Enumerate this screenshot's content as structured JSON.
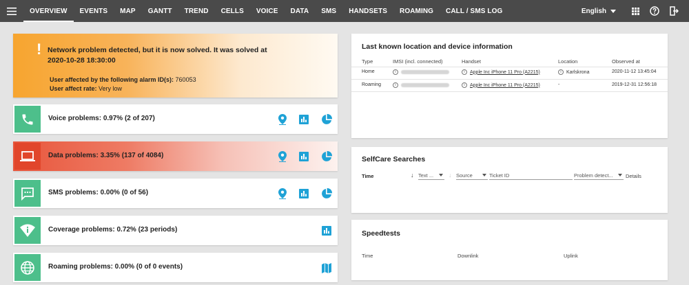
{
  "nav": {
    "items": [
      "OVERVIEW",
      "EVENTS",
      "MAP",
      "GANTT",
      "TREND",
      "CELLS",
      "VOICE",
      "DATA",
      "SMS",
      "HANDSETS",
      "ROAMING",
      "CALL / SMS LOG"
    ],
    "active": "OVERVIEW",
    "language": "English"
  },
  "alarm": {
    "message": "Network problem detected, but it is now solved. It was solved at 2020-10-28 18:30:00",
    "alarm_label": "User affected by the following alarm ID(s):",
    "alarm_ids": "760053",
    "rate_label": "User affect rate:",
    "rate_value": "Very low"
  },
  "problems": {
    "voice": "Voice problems: 0.97% (2 of 207)",
    "data": "Data problems: 3.35% (137 of 4084)",
    "sms": "SMS problems: 0.00% (0 of 56)",
    "coverage": "Coverage problems: 0.72% (23 periods)",
    "roaming": "Roaming problems: 0.00% (0 of 0 events)"
  },
  "location_card": {
    "title": "Last known location and device information",
    "headers": [
      "Type",
      "IMSI (incl. connected)",
      "Handset",
      "Location",
      "Observed at"
    ],
    "rows": [
      {
        "type": "Home",
        "handset": "Apple Inc iPhone 11 Pro (A2215)",
        "location": "Karlskrona",
        "observed": "2020-11-12 13:45:04"
      },
      {
        "type": "Roaming",
        "handset": "Apple Inc iPhone 11 Pro (A2215)",
        "location": "-",
        "observed": "2019-12-31 12:56:18"
      }
    ]
  },
  "selfcare": {
    "title": "SelfCare Searches",
    "time_label": "Time",
    "text_filter": "Text ...",
    "source_filter": "Source",
    "ticket_filter": "Ticket ID",
    "problem_filter": "Problem detect...",
    "details_label": "Details"
  },
  "speedtests": {
    "title": "Speedtests",
    "headers": [
      "Time",
      "Downlink",
      "Uplink"
    ]
  },
  "colors": {
    "topbar": "#4a4a4a",
    "accent": "#1fa2d6",
    "ok_green": "#4dbf8b",
    "error_red": "#e1462b",
    "warning_orange": "#f7a52f"
  }
}
